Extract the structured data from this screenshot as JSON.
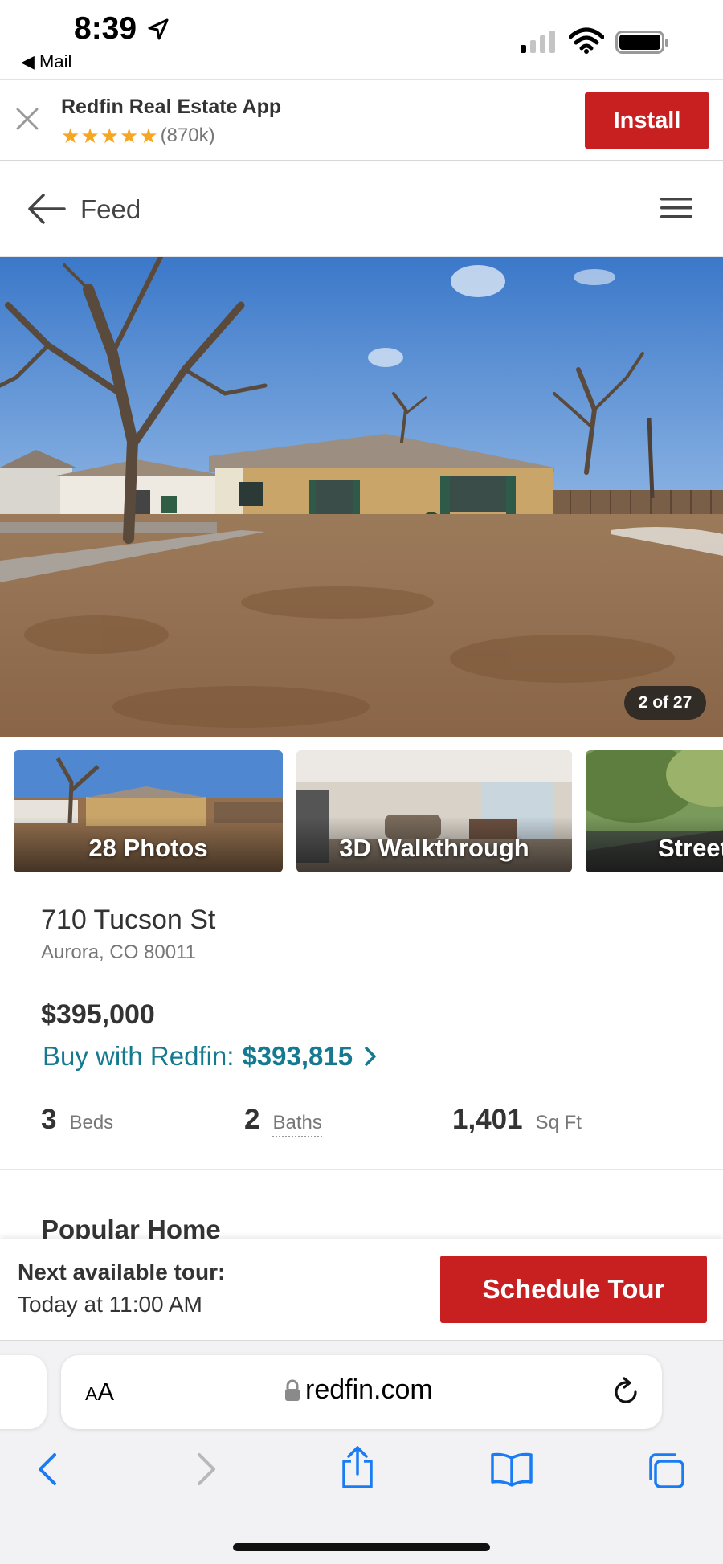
{
  "status_bar": {
    "time": "8:39",
    "back_label": "◀ Mail"
  },
  "app_banner": {
    "app_name": "Redfin Real Estate App",
    "rating_stars": 5,
    "review_count": "(870k)",
    "install_label": "Install"
  },
  "nav": {
    "title": "Feed"
  },
  "hero": {
    "photo_counter": "2 of 27"
  },
  "thumbnails": [
    {
      "label": "28 Photos"
    },
    {
      "label": "3D Walkthrough"
    },
    {
      "label": "Street"
    }
  ],
  "listing": {
    "street": "710 Tucson St",
    "city_line": "Aurora, CO 80011",
    "price": "$395,000",
    "buy_with_label": "Buy with Redfin:",
    "buy_with_price": "$393,815",
    "beds_value": "3",
    "beds_label": "Beds",
    "baths_value": "2",
    "baths_label": "Baths",
    "sqft_value": "1,401",
    "sqft_label": "Sq Ft",
    "next_section": "Popular Home"
  },
  "tour_bar": {
    "heading": "Next available tour:",
    "time": "Today at 11:00 AM",
    "button_label": "Schedule Tour"
  },
  "browser": {
    "aa_label": "AA",
    "url": "redfin.com"
  },
  "colors": {
    "brand_red": "#c82021",
    "link_teal": "#157a8f",
    "star_gold": "#f5a623",
    "ios_blue": "#1a7cf5"
  }
}
